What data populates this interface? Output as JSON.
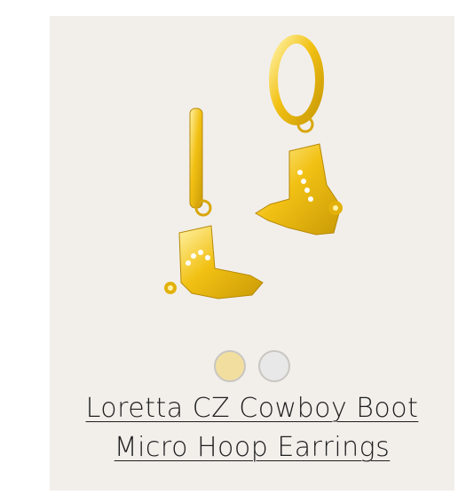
{
  "product": {
    "title_line1": "Loretta CZ Cowboy Boot",
    "title_line2": "Micro Hoop Earrings",
    "image_icon": "cowboy-boot-earrings"
  },
  "swatches": [
    {
      "name": "gold",
      "color": "#f2dfa0"
    },
    {
      "name": "silver",
      "color": "#e8e8e8"
    }
  ],
  "colors": {
    "card_background": "#f2efeb",
    "gold": "#f2c114",
    "gold_shadow": "#c99a06"
  }
}
